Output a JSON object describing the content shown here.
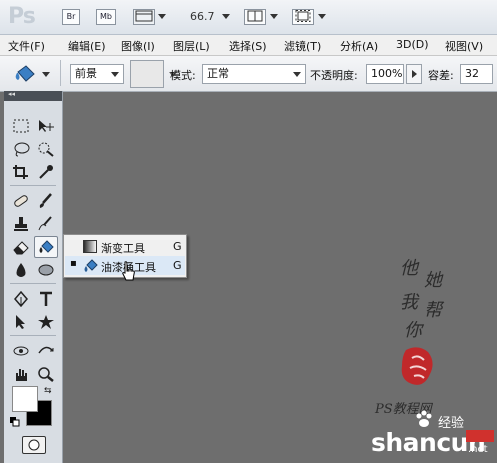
{
  "appbar": {
    "logo": "Ps",
    "bridge_label": "Br",
    "minibridge_label": "Mb",
    "zoom": "66.7"
  },
  "menubar": {
    "items": [
      "文件(F)",
      "编辑(E)",
      "图像(I)",
      "图层(L)",
      "选择(S)",
      "滤镜(T)",
      "分析(A)",
      "3D(D)",
      "视图(V)"
    ]
  },
  "options": {
    "fill_source": "前景",
    "mode_label": "模式:",
    "mode_value": "正常",
    "opacity_label": "不透明度:",
    "opacity_value": "100%",
    "tolerance_label": "容差:",
    "tolerance_value": "32"
  },
  "toolbox": {
    "collapse_glyph": "◂◂"
  },
  "flyout": {
    "items": [
      {
        "label": "渐变工具",
        "key": "G",
        "icon": "gradient-icon",
        "selected": false
      },
      {
        "label": "油漆桶工具",
        "key": "G",
        "icon": "paint-bucket-icon",
        "selected": true
      }
    ],
    "selected_marker": "▪"
  },
  "watermark": {
    "signature_chars": [
      "他",
      "她",
      "我",
      "帮",
      "你"
    ],
    "ps_text": "PS教程网",
    "brand": "shancun",
    "brand_suffix": ".net",
    "brand_cn": "经验"
  },
  "colors": {
    "canvas_bg": "#6e6e6e",
    "foreground": "#ffffff",
    "background": "#000000",
    "brand_blue": "#2a6fc9",
    "seal_red": "#c0282a"
  }
}
